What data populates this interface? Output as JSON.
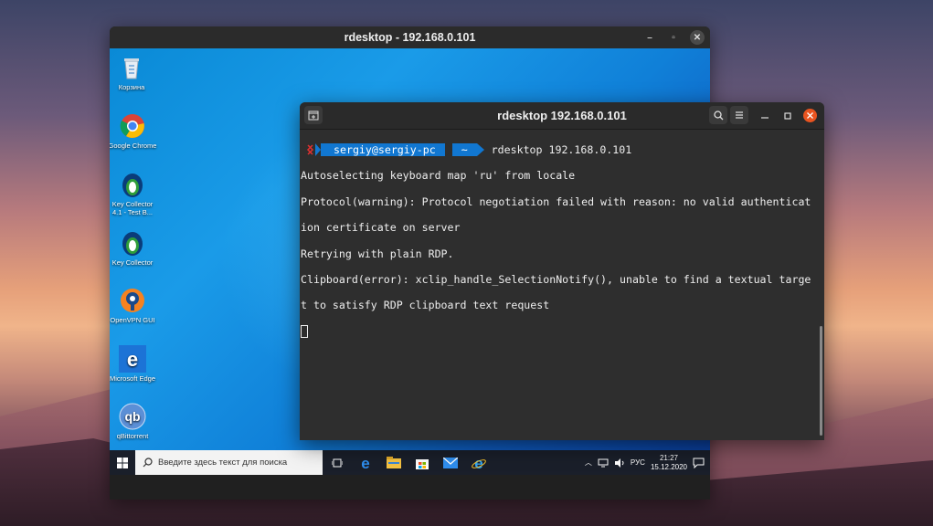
{
  "rdesktop_window": {
    "title": "rdesktop - 192.168.0.101",
    "controls": {
      "minimize": "–",
      "maximize": "▫",
      "close": "✕"
    }
  },
  "desktop_icons": [
    {
      "label": "Корзина",
      "icon": "recycle-bin-icon"
    },
    {
      "label": "Google Chrome",
      "icon": "chrome-icon"
    },
    {
      "label": "Key Collector 4.1 - Test B...",
      "icon": "key-collector-icon"
    },
    {
      "label": "Key Collector",
      "icon": "key-collector-icon"
    },
    {
      "label": "OpenVPN GUI",
      "icon": "openvpn-icon"
    },
    {
      "label": "Microsoft Edge",
      "icon": "edge-icon"
    },
    {
      "label": "qBittorrent",
      "icon": "qbittorrent-icon"
    }
  ],
  "taskbar": {
    "search_placeholder": "Введите здесь текст для поиска",
    "apps": [
      "task-view-icon",
      "edge-icon",
      "file-explorer-icon",
      "store-icon",
      "mail-icon",
      "ie-icon"
    ],
    "language": "РУС",
    "time": "21:27",
    "date": "15.12.2020"
  },
  "terminal": {
    "title": "rdesktop 192.168.0.101",
    "prompt": {
      "user": "sergiy@sergiy-pc",
      "dir": "~",
      "command": "rdesktop 192.168.0.101"
    },
    "lines": [
      "Autoselecting keyboard map 'ru' from locale",
      "Protocol(warning): Protocol negotiation failed with reason: no valid authenticat",
      "ion certificate on server",
      "Retrying with plain RDP.",
      "Clipboard(error): xclip_handle_SelectionNotify(), unable to find a textual targe",
      "t to satisfy RDP clipboard text request"
    ]
  },
  "colors": {
    "prompt_bg": "#1177d1",
    "close_accent": "#e95420",
    "terminal_bg": "#2e2e2e"
  }
}
